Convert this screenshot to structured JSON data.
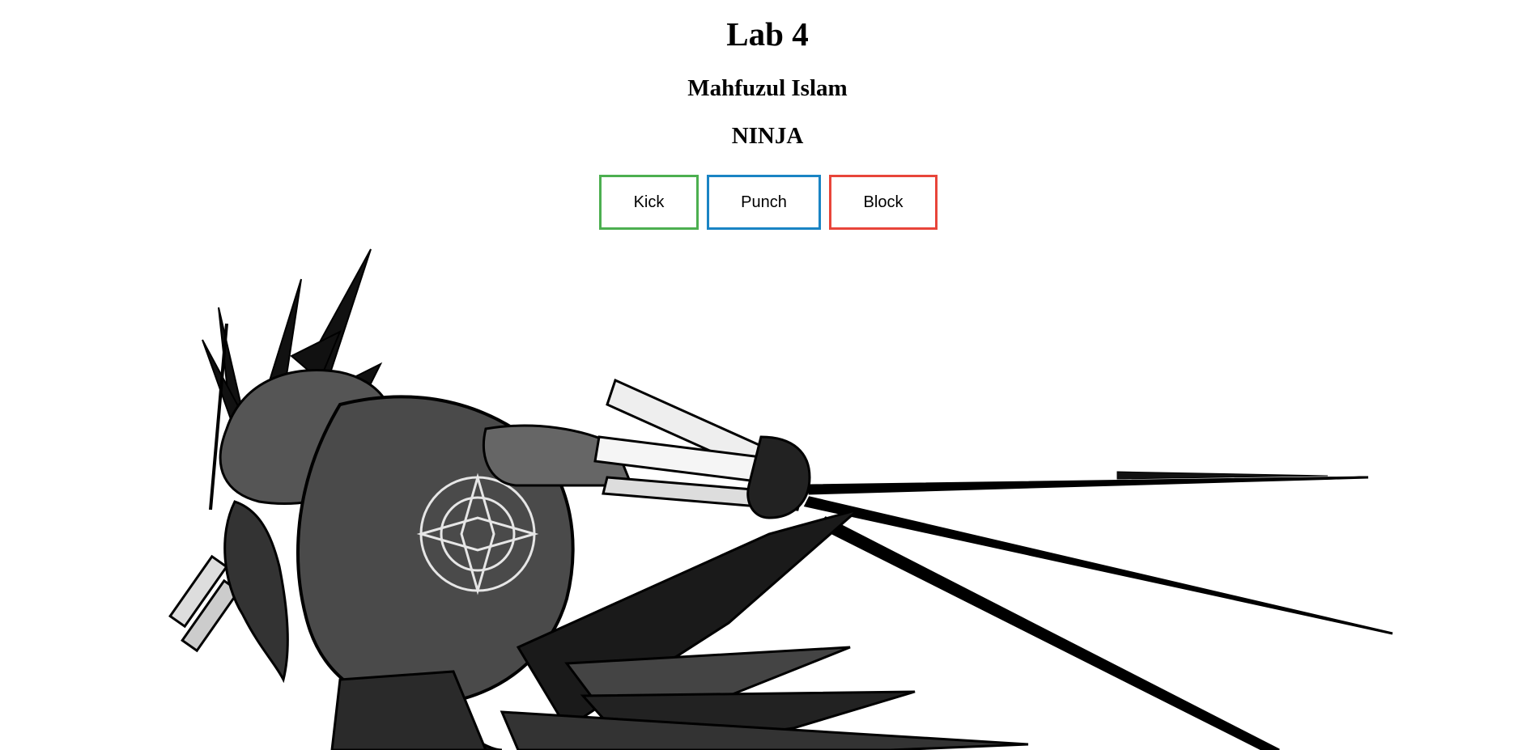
{
  "page": {
    "title": "Lab 4",
    "author": "Mahfuzul Islam",
    "subtitle": "NINJA"
  },
  "buttons": {
    "kick": {
      "label": "Kick",
      "border_color": "#4caf50"
    },
    "punch": {
      "label": "Punch",
      "border_color": "#1a84c4"
    },
    "block": {
      "label": "Block",
      "border_color": "#e8453a"
    }
  },
  "image": {
    "subject": "ninja-illustration",
    "style": "black-and-white ink drawing"
  }
}
